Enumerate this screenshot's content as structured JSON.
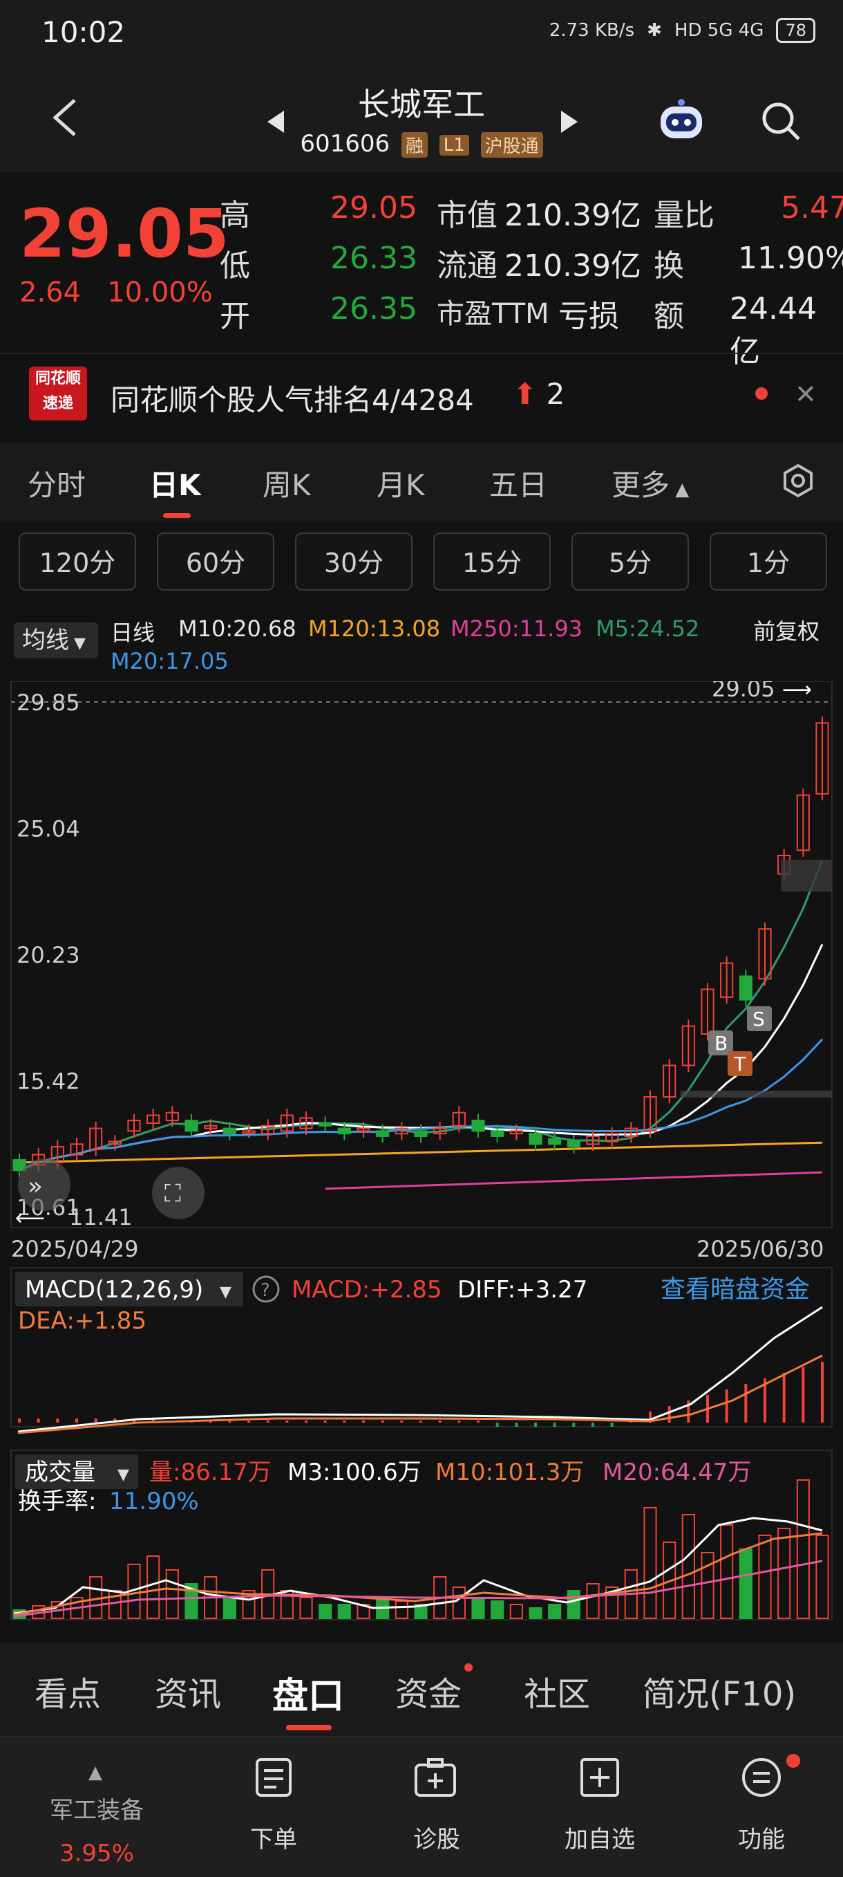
{
  "status": {
    "time": "10:02",
    "speed": "2.73 KB/s",
    "indicators": "HD 5G 4G",
    "battery": "78"
  },
  "header": {
    "title": "长城军工",
    "code": "601606",
    "tags": [
      "融",
      "L1",
      "沪股通"
    ]
  },
  "quote": {
    "price": "29.05",
    "change": "2.64",
    "change_pct": "10.00%",
    "high_label": "高",
    "high": "29.05",
    "low_label": "低",
    "low": "26.33",
    "open_label": "开",
    "open": "26.35",
    "mcap_label": "市值",
    "mcap": "210.39亿",
    "float_label": "流通",
    "float": "210.39亿",
    "pe_label": "市盈TTM",
    "pe": "亏损",
    "vol_ratio_label": "量比",
    "vol_ratio": "5.47",
    "turnover_label": "换",
    "turnover": "11.90%",
    "amount_label": "额",
    "amount": "24.44亿"
  },
  "popularity": {
    "logo_line1": "同花顺",
    "logo_line2": "速递",
    "text": "同花顺个股人气排名4/4284",
    "rank_change": "2"
  },
  "tabs": [
    "分时",
    "日K",
    "周K",
    "月K",
    "五日",
    "更多"
  ],
  "periods": [
    "120分",
    "60分",
    "30分",
    "15分",
    "5分",
    "1分"
  ],
  "ma": {
    "select": "均线",
    "kind": "日线",
    "m10": "M10:20.68",
    "m120": "M120:13.08",
    "m250": "M250:11.93",
    "m5": "M5:24.52",
    "adjust": "前复权",
    "m20": "M20:17.05"
  },
  "chart_data": {
    "type": "candlestick",
    "y_ticks": [
      "29.85",
      "25.04",
      "20.23",
      "15.42",
      "10.61"
    ],
    "ylim": [
      10.61,
      29.85
    ],
    "max_label": "29.05",
    "min_label": "11.41",
    "start_date": "2025/04/29",
    "end_date": "2025/06/30",
    "candles": [
      {
        "o": 12.4,
        "c": 12.0
      },
      {
        "o": 12.2,
        "c": 12.6
      },
      {
        "o": 12.3,
        "c": 12.9
      },
      {
        "o": 12.6,
        "c": 13.0
      },
      {
        "o": 12.8,
        "c": 13.6
      },
      {
        "o": 13.0,
        "c": 13.1
      },
      {
        "o": 13.5,
        "c": 13.9
      },
      {
        "o": 13.8,
        "c": 14.1
      },
      {
        "o": 13.9,
        "c": 14.2
      },
      {
        "o": 13.9,
        "c": 13.5
      },
      {
        "o": 13.6,
        "c": 13.7
      },
      {
        "o": 13.6,
        "c": 13.4
      },
      {
        "o": 13.5,
        "c": 13.5
      },
      {
        "o": 13.4,
        "c": 13.7
      },
      {
        "o": 13.5,
        "c": 14.1
      },
      {
        "o": 13.6,
        "c": 14.0
      },
      {
        "o": 13.8,
        "c": 13.7
      },
      {
        "o": 13.6,
        "c": 13.4
      },
      {
        "o": 13.5,
        "c": 13.6
      },
      {
        "o": 13.5,
        "c": 13.3
      },
      {
        "o": 13.4,
        "c": 13.6
      },
      {
        "o": 13.5,
        "c": 13.3
      },
      {
        "o": 13.4,
        "c": 13.6
      },
      {
        "o": 13.7,
        "c": 14.2
      },
      {
        "o": 13.9,
        "c": 13.5
      },
      {
        "o": 13.5,
        "c": 13.3
      },
      {
        "o": 13.4,
        "c": 13.5
      },
      {
        "o": 13.4,
        "c": 13.0
      },
      {
        "o": 13.2,
        "c": 13.0
      },
      {
        "o": 13.1,
        "c": 12.9
      },
      {
        "o": 13.0,
        "c": 13.3
      },
      {
        "o": 13.1,
        "c": 13.4
      },
      {
        "o": 13.3,
        "c": 13.6
      },
      {
        "o": 13.5,
        "c": 14.8
      },
      {
        "o": 14.8,
        "c": 16.0
      },
      {
        "o": 16.0,
        "c": 17.5
      },
      {
        "o": 17.2,
        "c": 18.9
      },
      {
        "o": 18.6,
        "c": 19.9
      },
      {
        "o": 19.4,
        "c": 18.5
      },
      {
        "o": 19.3,
        "c": 21.2
      },
      {
        "o": 23.3,
        "c": 24.0
      },
      {
        "o": 24.2,
        "c": 26.3
      },
      {
        "o": 26.35,
        "c": 29.05
      }
    ],
    "macd": {
      "label": "MACD(12,26,9)",
      "macd": "MACD:+2.85",
      "diff": "DIFF:+3.27",
      "dea": "DEA:+1.85"
    },
    "volume": {
      "label": "成交量",
      "vol": "量:86.17万",
      "m3": "M3:100.6万",
      "m10": "M10:101.3万",
      "m20": "M20:64.47万",
      "turnover_label": "换手率:",
      "turnover": "11.90%"
    }
  },
  "dark_pool_link": "查看暗盘资金",
  "bottom_tabs": [
    "看点",
    "资讯",
    "盘口",
    "资金",
    "社区",
    "简况(F10)"
  ],
  "bottom_nav": {
    "sector": "军工装备",
    "sector_pct": "3.95%",
    "items": [
      "下单",
      "诊股",
      "加自选",
      "功能"
    ]
  },
  "colors": {
    "up": "#f24236",
    "down": "#23a83c",
    "m10": "#ffffff",
    "m120": "#f5a623",
    "m250": "#e03fa0",
    "m5": "#2f9c6a",
    "m20": "#3d97e6"
  }
}
